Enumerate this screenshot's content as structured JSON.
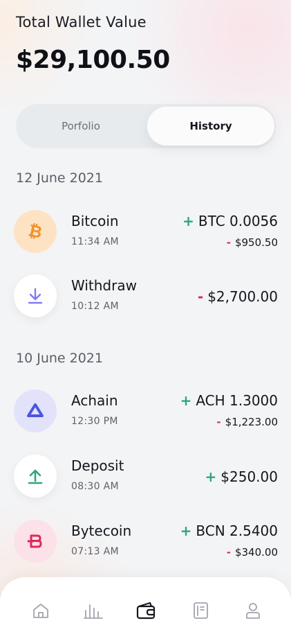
{
  "header": {
    "title": "Total Wallet Value",
    "value": "$29,100.50"
  },
  "tabs": [
    {
      "label": "Porfolio",
      "active": false
    },
    {
      "label": "History",
      "active": true
    }
  ],
  "groups": [
    {
      "date": "12 June 2021",
      "items": [
        {
          "name": "Bitcoin",
          "time": "11:34 AM",
          "sign": "+",
          "amount": "BTC 0.0056",
          "sub_sign": "-",
          "sub_amount": "$950.50",
          "icon": "bitcoin-icon"
        },
        {
          "name": "Withdraw",
          "time": "10:12 AM",
          "sign": "-",
          "amount": "$2,700.00",
          "icon": "arrow-down-icon"
        }
      ]
    },
    {
      "date": "10 June 2021",
      "items": [
        {
          "name": "Achain",
          "time": "12:30 PM",
          "sign": "+",
          "amount": "ACH 1.3000",
          "sub_sign": "-",
          "sub_amount": "$1,223.00",
          "icon": "achain-icon"
        },
        {
          "name": "Deposit",
          "time": "08:30 AM",
          "sign": "+",
          "amount": "$250.00",
          "icon": "arrow-up-icon"
        },
        {
          "name": "Bytecoin",
          "time": "07:13 AM",
          "sign": "+",
          "amount": "BCN 2.5400",
          "sub_sign": "-",
          "sub_amount": "$340.00",
          "icon": "bytecoin-icon"
        }
      ]
    }
  ],
  "nav": [
    "home-icon",
    "chart-icon",
    "wallet-icon",
    "document-icon",
    "profile-icon"
  ],
  "colors": {
    "positive": "#2aa876",
    "negative": "#e0285a",
    "accent": "#15161d"
  }
}
